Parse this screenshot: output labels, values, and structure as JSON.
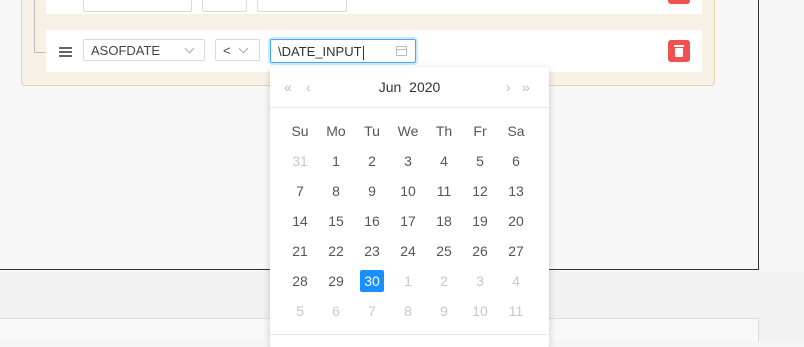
{
  "filter": {
    "field_label": "ASOFDATE",
    "operator_label": "<",
    "value_input": "\\DATE_INPUT"
  },
  "date_picker": {
    "month": "Jun",
    "year": "2020",
    "weekdays": [
      "Su",
      "Mo",
      "Tu",
      "We",
      "Th",
      "Fr",
      "Sa"
    ],
    "weeks": [
      [
        {
          "d": "31",
          "m": true
        },
        {
          "d": "1"
        },
        {
          "d": "2"
        },
        {
          "d": "3"
        },
        {
          "d": "4"
        },
        {
          "d": "5"
        },
        {
          "d": "6"
        }
      ],
      [
        {
          "d": "7"
        },
        {
          "d": "8"
        },
        {
          "d": "9"
        },
        {
          "d": "10"
        },
        {
          "d": "11"
        },
        {
          "d": "12"
        },
        {
          "d": "13"
        }
      ],
      [
        {
          "d": "14"
        },
        {
          "d": "15"
        },
        {
          "d": "16"
        },
        {
          "d": "17"
        },
        {
          "d": "18"
        },
        {
          "d": "19"
        },
        {
          "d": "20"
        }
      ],
      [
        {
          "d": "21"
        },
        {
          "d": "22"
        },
        {
          "d": "23"
        },
        {
          "d": "24"
        },
        {
          "d": "25"
        },
        {
          "d": "26"
        },
        {
          "d": "27"
        }
      ],
      [
        {
          "d": "28"
        },
        {
          "d": "29"
        },
        {
          "d": "30",
          "s": true
        },
        {
          "d": "1",
          "m": true
        },
        {
          "d": "2",
          "m": true
        },
        {
          "d": "3",
          "m": true
        },
        {
          "d": "4",
          "m": true
        }
      ],
      [
        {
          "d": "5",
          "m": true
        },
        {
          "d": "6",
          "m": true
        },
        {
          "d": "7",
          "m": true
        },
        {
          "d": "8",
          "m": true
        },
        {
          "d": "9",
          "m": true
        },
        {
          "d": "10",
          "m": true
        },
        {
          "d": "11",
          "m": true
        }
      ]
    ]
  },
  "colors": {
    "accent": "#1890ff",
    "danger": "#f05050",
    "group_bg": "#f8f2e6"
  }
}
